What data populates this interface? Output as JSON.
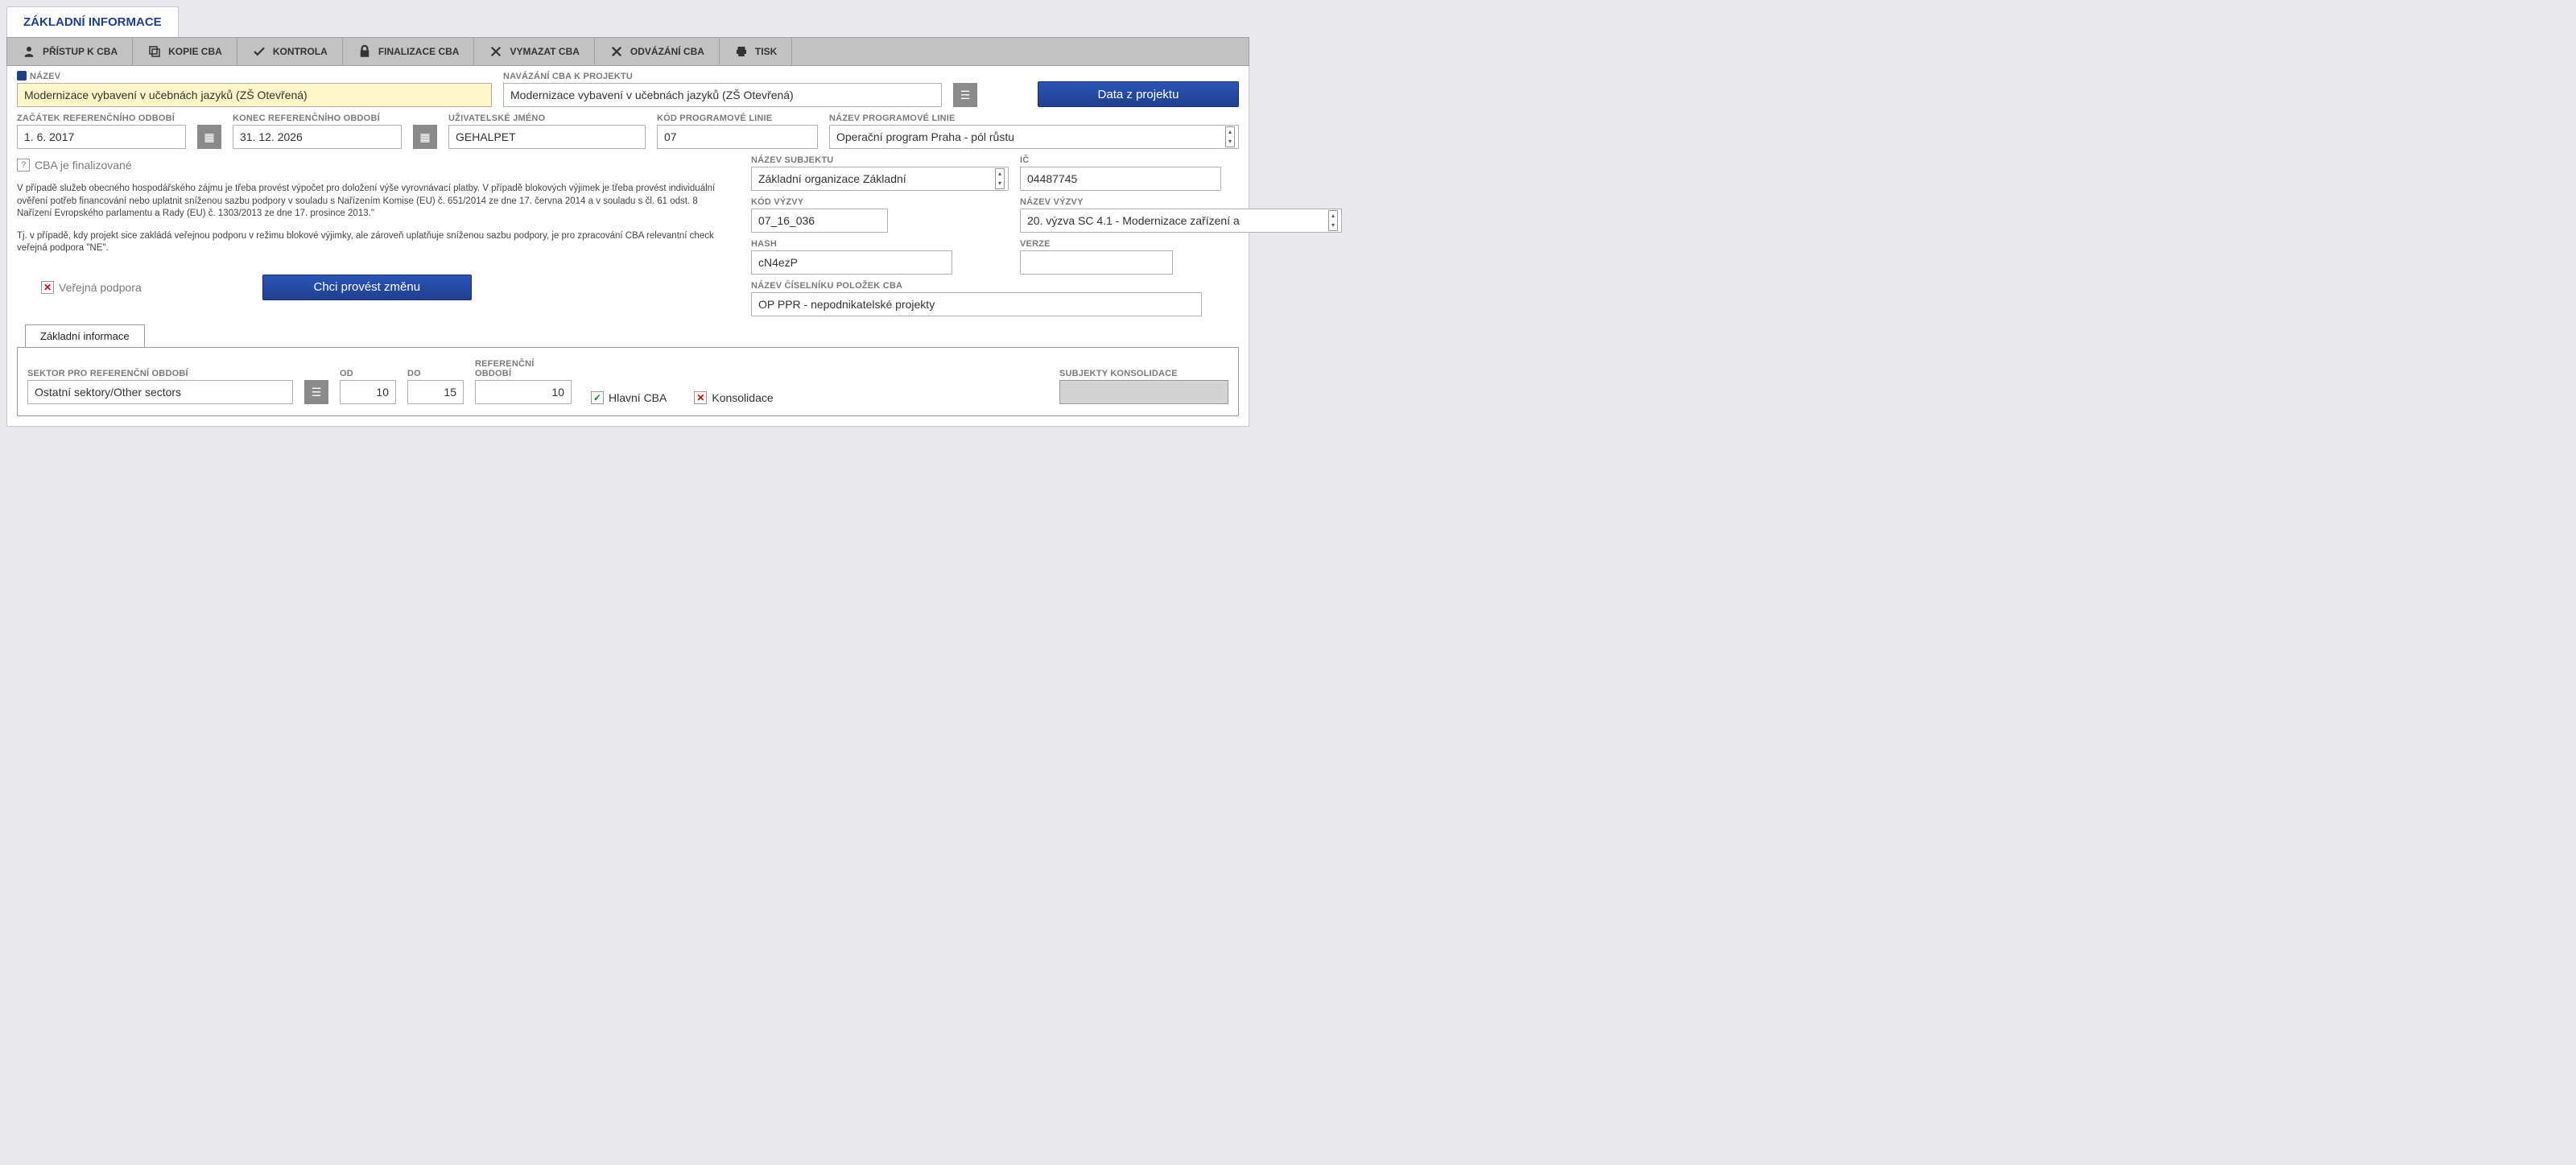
{
  "tab_main": "ZÁKLADNÍ INFORMACE",
  "toolbar": {
    "pristup": "PŘÍSTUP K CBA",
    "kopie": "KOPIE CBA",
    "kontrola": "KONTROLA",
    "finalizace": "FINALIZACE CBA",
    "vymazat": "VYMAZAT CBA",
    "odvazani": "ODVÁZÁNÍ CBA",
    "tisk": "TISK"
  },
  "labels": {
    "nazev": "NÁZEV",
    "navazani": "NAVÁZÁNÍ CBA K PROJEKTU",
    "zacatek": "ZAČÁTEK REFERENČNÍHO ODBOBÍ",
    "konec": "KONEC REFERENČNÍHO OBDOBÍ",
    "uzivatel": "UŽIVATELSKÉ JMÉNO",
    "kod_linie": "KÓD PROGRAMOVÉ LINIE",
    "nazev_linie": "NÁZEV PROGRAMOVÉ LINIE",
    "nazev_subjektu": "NÁZEV SUBJEKTU",
    "ic": "IČ",
    "kod_vyzvy": "KÓD VÝZVY",
    "nazev_vyzvy": "NÁZEV VÝZVY",
    "hash": "HASH",
    "verze": "VERZE",
    "nazev_ciselniku": "NÁZEV ČÍSELNÍKU POLOŽEK CBA",
    "sektor": "SEKTOR PRO REFERENČNÍ OBDOBÍ",
    "od": "OD",
    "do": "DO",
    "ref_obdobi": "REFERENČNÍ OBDOBÍ",
    "subjekty_kons": "SUBJEKTY KONSOLIDACE"
  },
  "values": {
    "nazev": "Modernizace vybavení v učebnách jazyků (ZŠ Otevřená)",
    "navazani": "Modernizace vybavení v učebnách jazyků (ZŠ Otevřená)",
    "zacatek": "1. 6. 2017",
    "konec": "31. 12. 2026",
    "uzivatel": "GEHALPET",
    "kod_linie": "07",
    "nazev_linie": "Operační program Praha - pól růstu",
    "nazev_subjektu": "Základní organizace Základní",
    "ic": "04487745",
    "kod_vyzvy": "07_16_036",
    "nazev_vyzvy": "20. výzva SC 4.1 - Modernizace zařízení a",
    "hash": "cN4ezP",
    "verze": "",
    "nazev_ciselniku": "OP PPR - nepodnikatelské projekty",
    "sektor": "Ostatní sektory/Other sectors",
    "od": "10",
    "do": "15",
    "ref_obdobi": "10"
  },
  "text": {
    "finalized": "CBA je finalizované",
    "info1": "V případě služeb obecného hospodářského zájmu je třeba provést výpočet pro doložení výše vyrovnávací platby. V případě blokových výjimek je třeba provést individuální ověření potřeb financování nebo uplatnit sníženou sazbu podpory v souladu s Nařízením Komise (EU) č. 651/2014 ze dne 17. června 2014 a v souladu s čl. 61 odst. 8 Nařízení Evropského parlamentu a Rady (EU) č. 1303/2013 ze dne 17. prosince 2013.\"",
    "info2": "Tj. v případě, kdy projekt sice zakládá veřejnou podporu v režimu blokové výjimky, ale zároveň uplatňuje sníženou sazbu podpory, je pro zpracování CBA relevantní check veřejná podpora \"NE\".",
    "verejna": "Veřejná podpora",
    "hlavni_cba": "Hlavní CBA",
    "konsolidace": "Konsolidace"
  },
  "buttons": {
    "data_projektu": "Data z projektu",
    "zmena": "Chci provést změnu"
  },
  "subtab": "Základní informace"
}
